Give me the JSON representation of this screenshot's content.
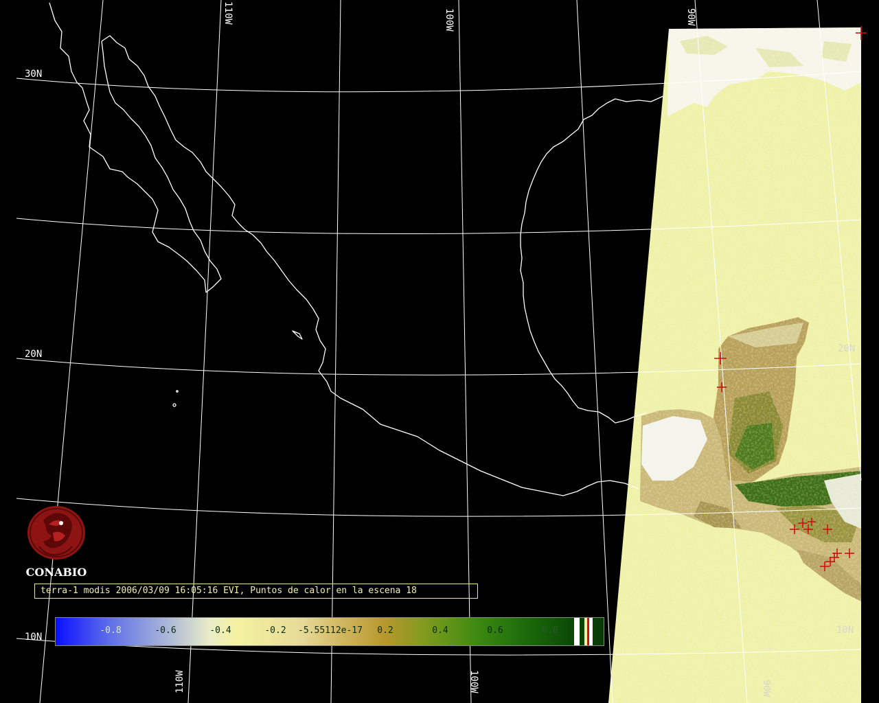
{
  "graticule": {
    "lat_labels": [
      "30N",
      "20N",
      "10N"
    ],
    "lon_labels_top": [
      "110W",
      "100W",
      "90W"
    ],
    "lon_labels_bottom": [
      "110W",
      "100W",
      "90W"
    ],
    "lat_labels_right": [
      "20N",
      "10N"
    ]
  },
  "logo": {
    "name": "CONABIO",
    "icon": "conabio-macaw-logo"
  },
  "caption": "terra-1 modis 2006/03/09 16:05:16 EVI, Puntos de calor en la escena 18",
  "colorbar": {
    "ticks": [
      "-0.8",
      "-0.6",
      "-0.4",
      "-0.2",
      "-5.55112e-17",
      "0.2",
      "0.4",
      "0.6",
      "0.8"
    ]
  },
  "hotspot_icon": "plus-marker",
  "colors": {
    "background": "#000000",
    "coastline": "#ffffff",
    "grid": "#ffffff",
    "swath_base": "#eff2a8",
    "hotspot": "#cc1111",
    "caption_border": "#e8e8a0"
  }
}
